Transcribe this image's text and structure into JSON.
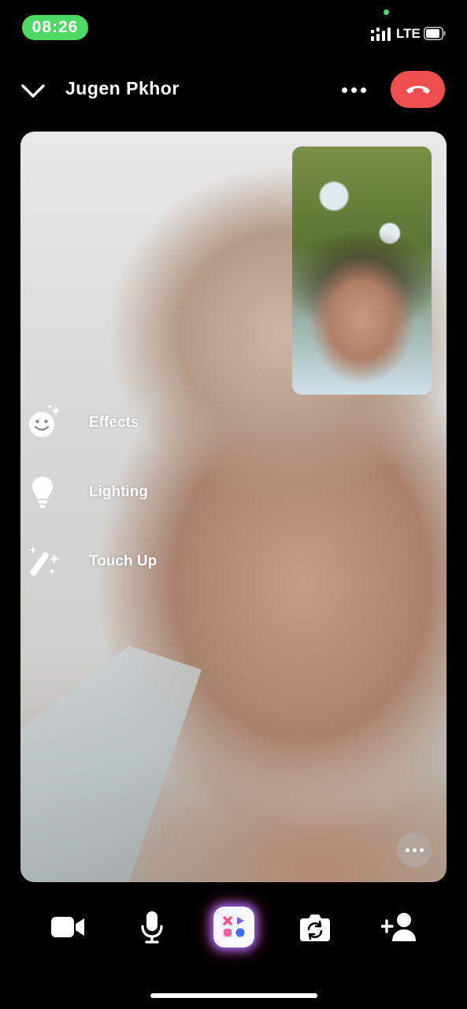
{
  "status_bar": {
    "time": "08:26",
    "network": "LTE"
  },
  "header": {
    "caller_name": "Jugen Pkhor"
  },
  "effects_menu": [
    {
      "label": "Effects",
      "icon": "smiley-sparkle-icon"
    },
    {
      "label": "Lighting",
      "icon": "lightbulb-icon"
    },
    {
      "label": "Touch Up",
      "icon": "magic-wand-icon"
    }
  ],
  "toolbar": [
    {
      "name": "video-camera-icon"
    },
    {
      "name": "microphone-icon"
    },
    {
      "name": "apps-icon"
    },
    {
      "name": "flip-camera-icon"
    },
    {
      "name": "add-person-icon"
    }
  ],
  "colors": {
    "end_call": "#ef4e4e",
    "time_pill": "#4cd964",
    "background": "#000000"
  }
}
